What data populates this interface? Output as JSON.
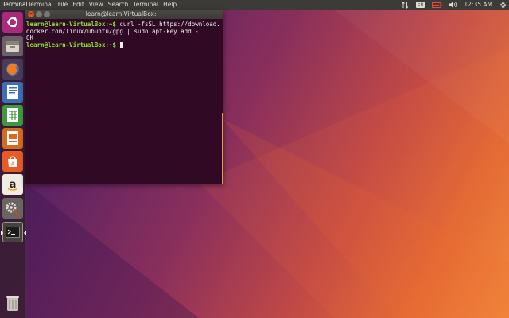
{
  "top_panel": {
    "app_name": "Terminal",
    "menu": [
      "Terminal",
      "File",
      "Edit",
      "View",
      "Search",
      "Terminal",
      "Help"
    ],
    "keyboard_layout": "En",
    "clock": "12:35 AM",
    "indicator_icons": [
      "network-updown-icon",
      "keyboard-layout-icon",
      "battery-icon",
      "volume-icon",
      "settings-gear-icon"
    ]
  },
  "launcher": {
    "items": [
      {
        "name": "ubuntu-dash-icon"
      },
      {
        "name": "files-icon"
      },
      {
        "name": "firefox-icon"
      },
      {
        "name": "libreoffice-writer-icon"
      },
      {
        "name": "libreoffice-calc-icon"
      },
      {
        "name": "libreoffice-impress-icon"
      },
      {
        "name": "ubuntu-software-icon"
      },
      {
        "name": "amazon-icon"
      },
      {
        "name": "system-settings-icon"
      },
      {
        "name": "terminal-icon",
        "running": true,
        "focused": true
      },
      {
        "name": "trash-icon"
      }
    ]
  },
  "terminal": {
    "title": "learn@learn-VirtualBox: ~",
    "prompt": "learn@learn-VirtualBox:~$",
    "lines": [
      {
        "prompt": "learn@learn-VirtualBox:~$",
        "text": " curl -fsSL https://download."
      },
      {
        "prompt": "",
        "text": "docker.com/linux/ubuntu/gpg | sudo apt-key add -"
      },
      {
        "prompt": "",
        "text": "OK"
      },
      {
        "prompt": "learn@learn-VirtualBox:~$",
        "text": " "
      }
    ]
  },
  "colors": {
    "panel": "#3c3b37",
    "terminal_bg": "#300a24",
    "prompt": "#8ae234",
    "close_button": "#e95420"
  }
}
